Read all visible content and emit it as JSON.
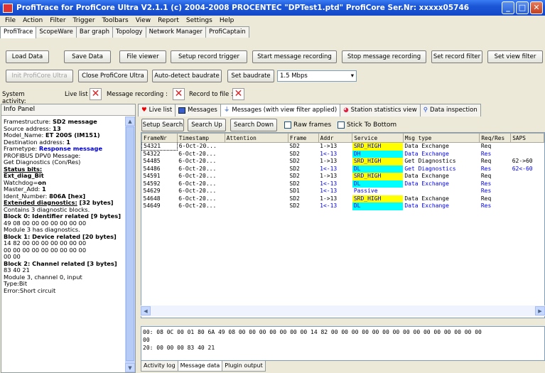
{
  "window": {
    "title": "ProfiTrace for ProfiCore Ultra V2.1.1 (c) 2004-2008 PROCENTEC  \"DPTest1.ptd\"  ProfiCore Ser.Nr: xxxxx05746"
  },
  "menu": [
    "File",
    "Action",
    "Filter",
    "Trigger",
    "Toolbars",
    "View",
    "Report",
    "Settings",
    "Help"
  ],
  "main_tabs": [
    "ProfiTrace",
    "ScopeWare",
    "Bar graph",
    "Topology",
    "Network Manager",
    "ProfiCaptain"
  ],
  "toolbar1": [
    "Load Data",
    "Save Data",
    "File viewer",
    "Setup record trigger",
    "Start message recording",
    "Stop message recording",
    "Set record filter",
    "Set view filter"
  ],
  "toolbar2": {
    "init": "Init ProfiCore Ultra",
    "close": "Close ProfiCore Ultra",
    "auto": "Auto-detect baudrate",
    "set": "Set baudrate",
    "baud": "1.5 Mbps"
  },
  "system": {
    "activity": "System activity:",
    "live": "Live list :",
    "recording": "Message recording :",
    "file": "Record to file :"
  },
  "info_panel": {
    "title": "Info Panel",
    "lines": [
      {
        "t": "Framestructure: ",
        "b": "SD2 message"
      },
      {
        "t": "Source address: ",
        "b": "13"
      },
      {
        "t": "Model_Name: ",
        "b": "ET 200S (IM151)"
      },
      {
        "t": "Destination address: ",
        "b": "1"
      },
      {
        "t": "Frametype: ",
        "b": "Response message",
        "c": "#0000cc"
      },
      {
        "t": " "
      },
      {
        "t": "PROFIBUS DPV0 Message:"
      },
      {
        "t": "Get Diagnostics (Con/Res)"
      },
      {
        "u": "Status bits:"
      },
      {
        "t": "  ",
        "b": "Ext_diag_Bit"
      },
      {
        "t": "   Watchdog=",
        "b": "on"
      },
      {
        "t": "Master_Add: ",
        "b": "1"
      },
      {
        "t": "Ident_Number: ",
        "b": "806A [hex]"
      },
      {
        "u": "Extended diagnostics:",
        "b": " [32 bytes]"
      },
      {
        "t": " Contains 3 diagnostic blocks."
      },
      {
        "b": "Block 0: Identifier related [9 bytes]"
      },
      {
        "t": "  49 08 00 00 00 00 00 00 00"
      },
      {
        "t": " "
      },
      {
        "t": "  Module 3 has diagnostics."
      },
      {
        "b": "Block 1: Device related [20 bytes]"
      },
      {
        "t": "  14 82 00 00 00 00 00 00 00"
      },
      {
        "t": "  00 00 00 00 00 00 00 00 00"
      },
      {
        "t": "  00 00"
      },
      {
        "b": "Block 2: Channel related [3 bytes]"
      },
      {
        "t": "  83 40 21"
      },
      {
        "t": "  Module 3, channel 0, input"
      },
      {
        "t": "  Type:Bit"
      },
      {
        "t": "  Error:Short circuit"
      }
    ]
  },
  "view_tabs": [
    "Live list",
    "Messages",
    "Messages (with view filter applied)",
    "Station statistics view",
    "Data inspection"
  ],
  "search": {
    "setup": "Setup Search",
    "up": "Search Up",
    "down": "Search Down",
    "raw": "Raw frames",
    "stick": "Stick To Bottom"
  },
  "grid": {
    "headers": [
      "FrameNr",
      "Timestamp",
      "Attention",
      "Frame",
      "Addr",
      "Service",
      "Msg type",
      "Req/Res",
      "SAPS"
    ],
    "rows": [
      [
        "54321",
        "6-Oct-20...",
        "",
        "SD2",
        "1->13",
        "SRD_HIGH",
        "Data Exchange",
        "Req",
        ""
      ],
      [
        "54322",
        "6-Oct-20...",
        "",
        "SD2",
        "1<-13",
        "DH",
        "Data Exchange",
        "Res",
        ""
      ],
      [
        "54485",
        "6-Oct-20...",
        "",
        "SD2",
        "1->13",
        "SRD_HIGH",
        "Get Diagnostics",
        "Req",
        "62->60"
      ],
      [
        "54486",
        "6-Oct-20...",
        "",
        "SD2",
        "1<-13",
        "DL",
        "Get Diagnostics",
        "Res",
        "62<-60"
      ],
      [
        "54591",
        "6-Oct-20...",
        "",
        "SD2",
        "1->13",
        "SRD_HIGH",
        "Data Exchange",
        "Req",
        ""
      ],
      [
        "54592",
        "6-Oct-20...",
        "",
        "SD2",
        "1<-13",
        "DL",
        "Data Exchange",
        "Res",
        ""
      ],
      [
        "54629",
        "6-Oct-20...",
        "",
        "SD1",
        "1<-13",
        "Passive",
        "",
        "Res",
        ""
      ],
      [
        "54648",
        "6-Oct-20...",
        "",
        "SD2",
        "1->13",
        "SRD_HIGH",
        "Data Exchange",
        "Req",
        ""
      ],
      [
        "54649",
        "6-Oct-20...",
        "",
        "SD2",
        "1<-13",
        "DL",
        "Data Exchange",
        "Res",
        ""
      ]
    ]
  },
  "hex": [
    "00: 08 0C 00 01 80 6A 49 08 00 00 00 00 00 00 00 14  82 00 00 00 00 00 00 00  00 00 00 00 00 00 00 00",
    "00",
    "20: 00 00 00 83 40 21"
  ],
  "bottom_tabs": [
    "Activity log",
    "Message data",
    "Plugin output"
  ],
  "colors": {
    "title": "#1b56d6",
    "highlight_yellow": "#ffff00",
    "highlight_cyan": "#00ffff",
    "response_blue": "#0000ee"
  }
}
